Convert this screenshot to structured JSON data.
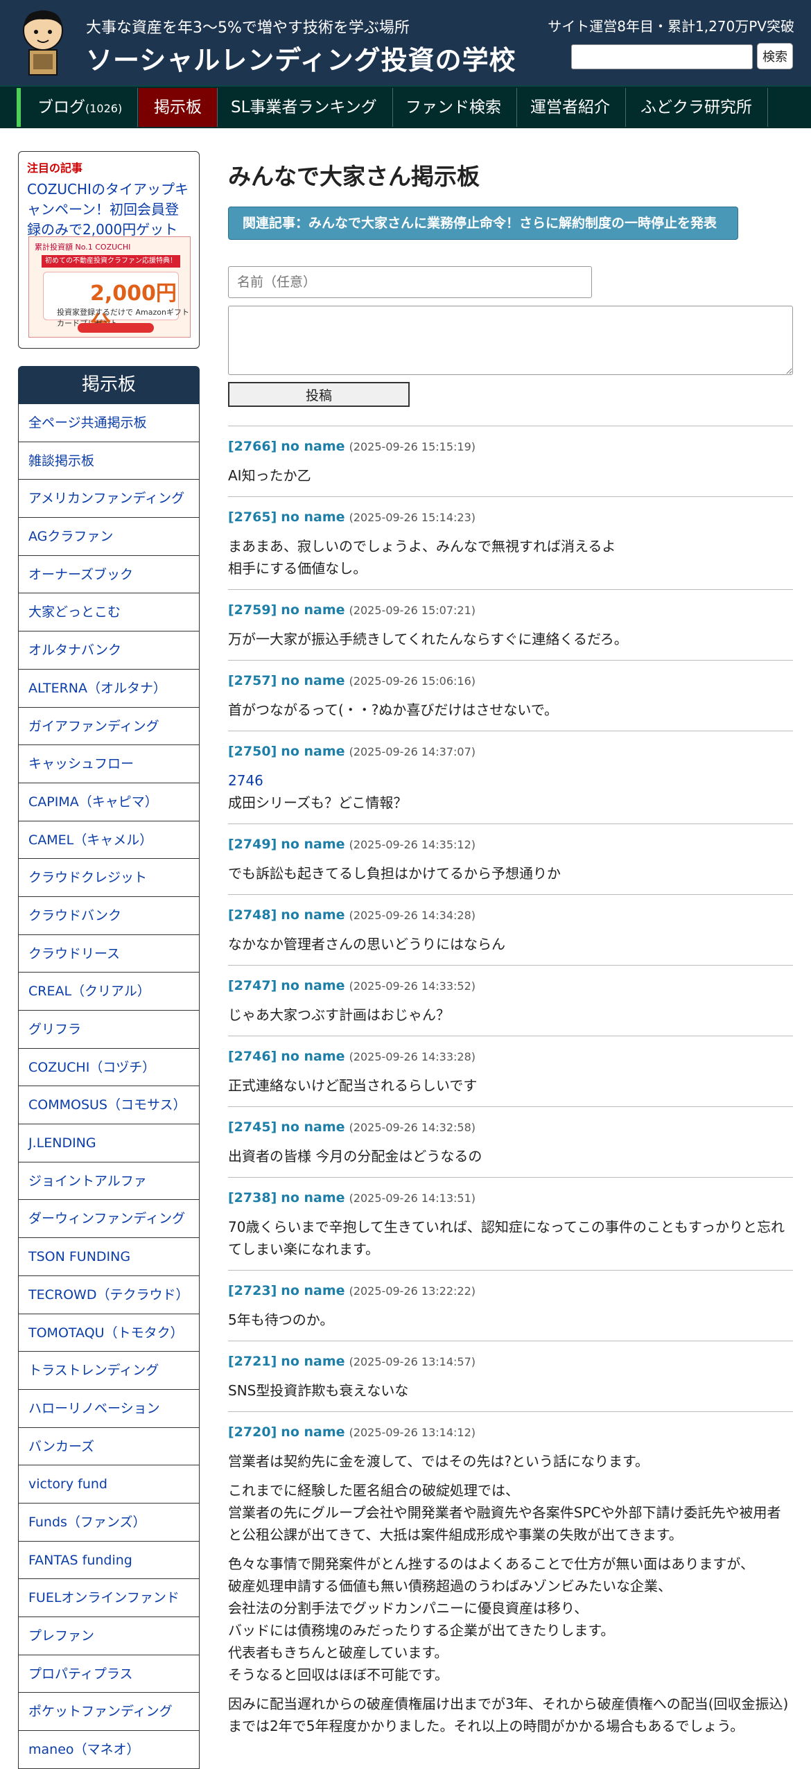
{
  "header": {
    "tagline": "大事な資産を年3〜5%で増やす技術を学ぶ場所",
    "site_title": "ソーシャルレンディング投資の学校",
    "stats": "サイト運営8年目・累計1,270万PV突破",
    "search_placeholder": "",
    "search_button": "検索"
  },
  "nav": {
    "items": [
      {
        "label": "ブログ",
        "count": "(1026)"
      },
      {
        "label": "掲示板"
      },
      {
        "label": "SL事業者ランキング"
      },
      {
        "label": "ファンド検索"
      },
      {
        "label": "運営者紹介"
      },
      {
        "label": "ふどクラ研究所"
      }
    ]
  },
  "sidebar": {
    "featured": {
      "label": "注目の記事",
      "text": "COZUCHIのタイアップキャンペーン！初回会員登録のみで2,000円ゲット",
      "banner": {
        "line1": "累計投資額 No.1 COZUCHI",
        "line2": "初めての不動産投資クラファン応援特典！",
        "amount": "2,000円分",
        "sub": "投資家登録するだけで Amazonギフトカードプレゼント"
      }
    },
    "bbs_title": "掲示板",
    "bbs_items": [
      "全ページ共通掲示板",
      "雑談掲示板",
      "アメリカンファンディング",
      "AGクラファン",
      "オーナーズブック",
      "大家どっとこむ",
      "オルタナバンク",
      "ALTERNA（オルタナ）",
      "ガイアファンディング",
      "キャッシュフロー",
      "CAPIMA（キャピマ）",
      "CAMEL（キャメル）",
      "クラウドクレジット",
      "クラウドバンク",
      "クラウドリース",
      "CREAL（クリアル）",
      "グリフラ",
      "COZUCHI（コヅチ）",
      "COMMOSUS（コモサス）",
      "J.LENDING",
      "ジョイントアルファ",
      "ダーウィンファンディング",
      "TSON FUNDING",
      "TECROWD（テクラウド）",
      "TOMOTAQU（トモタク）",
      "トラストレンディング",
      "ハローリノベーション",
      "バンカーズ",
      "victory fund",
      "Funds（ファンズ）",
      "FANTAS funding",
      "FUELオンラインファンド",
      "プレファン",
      "プロパティプラス",
      "ポケットファンディング",
      "maneo（マネオ）"
    ]
  },
  "main": {
    "title": "みんなで大家さん掲示板",
    "related": "関連記事：みんなで大家さんに業務停止命令！さらに解約制度の一時停止を発表",
    "name_placeholder": "名前（任意）",
    "post_button": "投稿",
    "posts": [
      {
        "num": "[2766]",
        "name": "no name",
        "date": "(2025-09-26 15:15:19)",
        "lines": [
          "AI知ったか乙"
        ]
      },
      {
        "num": "[2765]",
        "name": "no name",
        "date": "(2025-09-26 15:14:23)",
        "lines": [
          "まあまあ、寂しいのでしょうよ、みんなで無視すれば消えるよ\n相手にする価値なし。"
        ]
      },
      {
        "num": "[2759]",
        "name": "no name",
        "date": "(2025-09-26 15:07:21)",
        "lines": [
          "万が一大家が振込手続きしてくれたんならすぐに連絡くるだろ。"
        ]
      },
      {
        "num": "[2757]",
        "name": "no name",
        "date": "(2025-09-26 15:06:16)",
        "lines": [
          "首がつながるって(・・?ぬか喜びだけはさせないで。"
        ]
      },
      {
        "num": "[2750]",
        "name": "no name",
        "date": "(2025-09-26 14:37:07)",
        "link": "2746",
        "lines": [
          "成田シリーズも？どこ情報？"
        ]
      },
      {
        "num": "[2749]",
        "name": "no name",
        "date": "(2025-09-26 14:35:12)",
        "lines": [
          "でも訴訟も起きてるし負担はかけてるから予想通りか"
        ]
      },
      {
        "num": "[2748]",
        "name": "no name",
        "date": "(2025-09-26 14:34:28)",
        "lines": [
          "なかなか管理者さんの思いどうりにはならん"
        ]
      },
      {
        "num": "[2747]",
        "name": "no name",
        "date": "(2025-09-26 14:33:52)",
        "lines": [
          "じゃあ大家つぶす計画はおじゃん？"
        ]
      },
      {
        "num": "[2746]",
        "name": "no name",
        "date": "(2025-09-26 14:33:28)",
        "lines": [
          "正式連絡ないけど配当されるらしいです"
        ]
      },
      {
        "num": "[2745]",
        "name": "no name",
        "date": "(2025-09-26 14:32:58)",
        "lines": [
          "出資者の皆様 今月の分配金はどうなるの"
        ]
      },
      {
        "num": "[2738]",
        "name": "no name",
        "date": "(2025-09-26 14:13:51)",
        "lines": [
          "70歳くらいまで辛抱して生きていれば、認知症になってこの事件のこともすっかりと忘れてしまい楽になれます。"
        ]
      },
      {
        "num": "[2723]",
        "name": "no name",
        "date": "(2025-09-26 13:22:22)",
        "lines": [
          "5年も待つのか。"
        ]
      },
      {
        "num": "[2721]",
        "name": "no name",
        "date": "(2025-09-26 13:14:57)",
        "lines": [
          "SNS型投資詐欺も衰えないな"
        ]
      },
      {
        "num": "[2720]",
        "name": "no name",
        "date": "(2025-09-26 13:14:12)",
        "lines": [
          "営業者は契約先に金を渡して、ではその先は?という話になります。",
          "これまでに経験した匿名組合の破綻処理では、\n営業者の先にグループ会社や開発業者や融資先や各案件SPCや外部下請け委託先や被用者と公租公課が出てきて、大抵は案件組成形成や事業の失敗が出てきます。",
          "色々な事情で開発案件がとん挫するのはよくあることで仕方が無い面はありますが、\n破産処理申請する価値も無い債務超過のうわばみゾンビみたいな企業、\n会社法の分割手法でグッドカンパニーに優良資産は移り、\nバッドには債務塊のみだったりする企業が出てきたりします。\n代表者もきちんと破産しています。\nそうなると回収はほぼ不可能です。",
          "因みに配当遅れからの破産債権届け出までが3年、それから破産債権への配当(回収金振込)までは2年で5年程度かかりました。それ以上の時間がかかる場合もあるでしょう。"
        ]
      }
    ]
  }
}
